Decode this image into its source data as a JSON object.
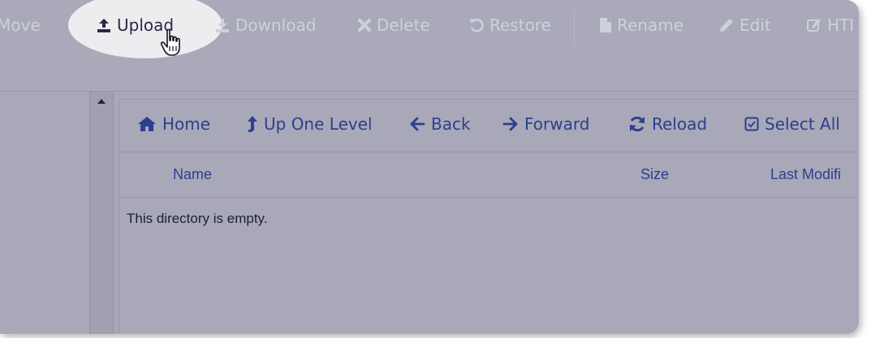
{
  "toolbar": {
    "move_label": "Move",
    "upload_label": "Upload",
    "download_label": "Download",
    "delete_label": "Delete",
    "restore_label": "Restore",
    "rename_label": "Rename",
    "edit_label": "Edit",
    "html_label": "HTI"
  },
  "nav": {
    "home_label": "Home",
    "up_label": "Up One Level",
    "back_label": "Back",
    "forward_label": "Forward",
    "reload_label": "Reload",
    "select_all_label": "Select All"
  },
  "table": {
    "columns": [
      "Name",
      "Size",
      "Last Modifi"
    ],
    "empty_message": "This directory is empty."
  },
  "colors": {
    "link_blue": "#2c3f8f",
    "disabled_text": "#cfd0de",
    "overlay_gray": "#a8a8b8",
    "spotlight": "#ededf0"
  },
  "icons": {
    "upload": "upload-icon",
    "download": "download-icon",
    "delete": "x-icon",
    "restore": "undo-icon",
    "rename": "file-icon",
    "edit": "pencil-icon",
    "html": "edit-square-icon",
    "home": "home-icon",
    "up": "level-up-icon",
    "back": "arrow-left-icon",
    "forward": "arrow-right-icon",
    "reload": "refresh-icon",
    "select_all": "checkbox-icon",
    "cursor": "hand-pointer-icon"
  }
}
